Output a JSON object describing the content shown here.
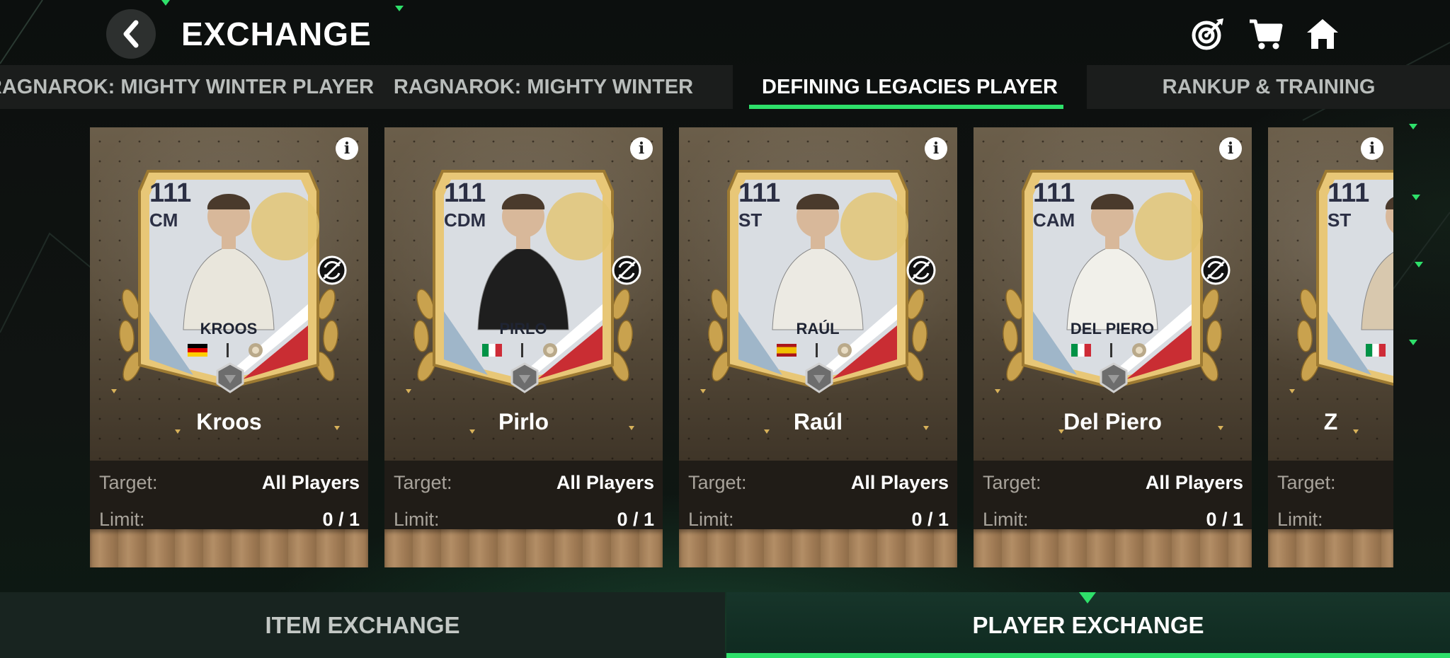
{
  "header": {
    "title": "EXCHANGE",
    "icons": [
      "target-icon",
      "cart-icon",
      "home-icon"
    ]
  },
  "tabs": [
    {
      "label": "RAGNAROK: MIGHTY WINTER PLAYER",
      "active": false
    },
    {
      "label": "RAGNAROK: MIGHTY WINTER",
      "active": false
    },
    {
      "label": "DEFINING LEGACIES PLAYER",
      "active": true
    },
    {
      "label": "RANKUP & TRAINING",
      "active": false
    }
  ],
  "cards": [
    {
      "rating": "111",
      "position": "CM",
      "card_name": "KROOS",
      "name": "Kroos",
      "target_label": "Target:",
      "target": "All Players",
      "limit_label": "Limit:",
      "limit": "0 / 1",
      "flag": "germany",
      "kit_color": "#e9e6dc"
    },
    {
      "rating": "111",
      "position": "CDM",
      "card_name": "PIRLO",
      "name": "Pirlo",
      "target_label": "Target:",
      "target": "All Players",
      "limit_label": "Limit:",
      "limit": "0 / 1",
      "flag": "italy",
      "kit_color": "#1e1e1e"
    },
    {
      "rating": "111",
      "position": "ST",
      "card_name": "RAÚL",
      "name": "Raúl",
      "target_label": "Target:",
      "target": "All Players",
      "limit_label": "Limit:",
      "limit": "0 / 1",
      "flag": "spain",
      "kit_color": "#eceae3"
    },
    {
      "rating": "111",
      "position": "CAM",
      "card_name": "DEL PIERO",
      "name": "Del Piero",
      "target_label": "Target:",
      "target": "All Players",
      "limit_label": "Limit:",
      "limit": "0 / 1",
      "flag": "italy",
      "kit_color": "#f1f0ea"
    },
    {
      "rating": "111",
      "position": "ST",
      "card_name": "Z",
      "name": "Z",
      "target_label": "Target:",
      "target": "",
      "limit_label": "Limit:",
      "limit": "",
      "flag": "italy",
      "kit_color": "#d8c8ae"
    }
  ],
  "bottom_tabs": [
    {
      "label": "ITEM EXCHANGE",
      "active": false
    },
    {
      "label": "PLAYER EXCHANGE",
      "active": true
    }
  ],
  "colors": {
    "accent": "#2ee06a",
    "card_bg": "#5a4e3c",
    "gold": "#d8b25a"
  }
}
